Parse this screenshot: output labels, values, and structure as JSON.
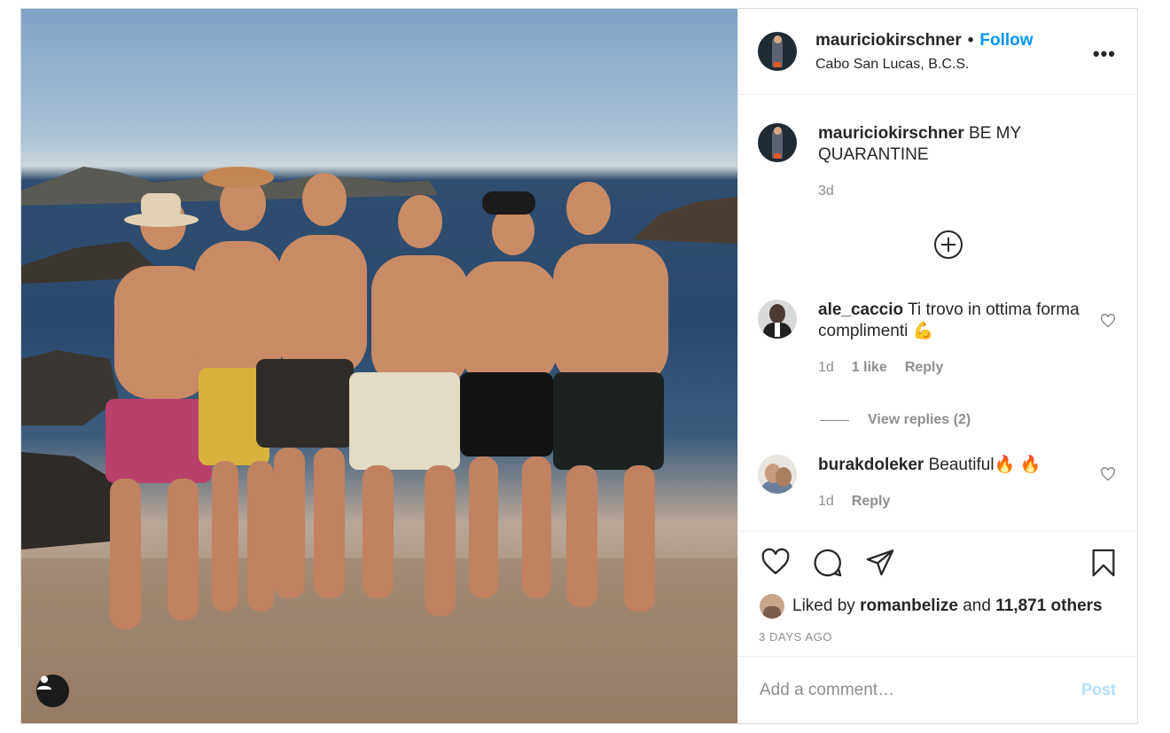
{
  "post": {
    "author": "mauriciokirschner",
    "follow_label": "Follow",
    "separator": "•",
    "location": "Cabo San Lucas, B.C.S.",
    "more_label": "•••"
  },
  "caption": {
    "username": "mauriciokirschner",
    "text": "BE MY QUARANTINE",
    "time": "3d"
  },
  "comments": [
    {
      "username": "ale_caccio",
      "text": "Ti trovo in ottima forma complimenti 💪",
      "time": "1d",
      "likes": "1 like",
      "reply_label": "Reply",
      "view_replies": "View replies (2)"
    },
    {
      "username": "burakdoleker",
      "text": "Beautiful🔥 🔥",
      "time": "1d",
      "reply_label": "Reply"
    }
  ],
  "likes": {
    "prefix": "Liked by",
    "user": "romanbelize",
    "and": "and",
    "others": "11,871 others"
  },
  "timestamp": "3 DAYS AGO",
  "add_comment": {
    "placeholder": "Add a comment…",
    "post_label": "Post"
  }
}
